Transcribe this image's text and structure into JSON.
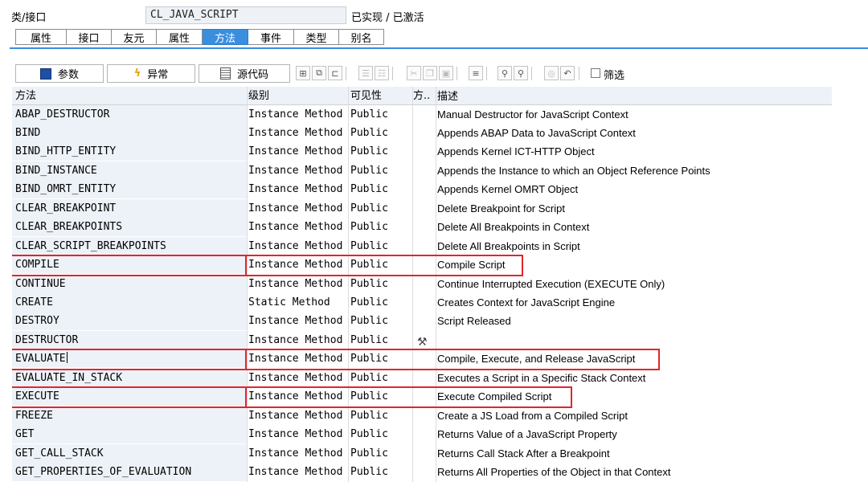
{
  "header": {
    "label": "类/接口",
    "class_name": "CL_JAVA_SCRIPT",
    "status": "已实现 / 已激活"
  },
  "tabs": [
    {
      "label": "属性",
      "active": false
    },
    {
      "label": "接口",
      "active": false
    },
    {
      "label": "友元",
      "active": false
    },
    {
      "label": "属性",
      "active": false
    },
    {
      "label": "方法",
      "active": true
    },
    {
      "label": "事件",
      "active": false
    },
    {
      "label": "类型",
      "active": false
    },
    {
      "label": "别名",
      "active": false
    }
  ],
  "toolbar": {
    "params_label": "参数",
    "exceptions_label": "异常",
    "source_label": "源代码",
    "filter_label": "筛选"
  },
  "columns": {
    "method": "方法",
    "level": "级别",
    "visibility": "可见性",
    "flag": "方.. ",
    "description": "描述"
  },
  "rows": [
    {
      "name": "ABAP_DESTRUCTOR",
      "level": "Instance Method",
      "visibility": "Public",
      "flag": "",
      "description": "Manual Destructor for JavaScript Context"
    },
    {
      "name": "BIND",
      "level": "Instance Method",
      "visibility": "Public",
      "flag": "",
      "description": "Appends ABAP Data to JavaScript Context"
    },
    {
      "name": "BIND_HTTP_ENTITY",
      "level": "Instance Method",
      "visibility": "Public",
      "flag": "",
      "description": "Appends Kernel ICT-HTTP Object"
    },
    {
      "name": "BIND_INSTANCE",
      "level": "Instance Method",
      "visibility": "Public",
      "flag": "",
      "description": "Appends the Instance to which an Object Reference Points"
    },
    {
      "name": "BIND_OMRT_ENTITY",
      "level": "Instance Method",
      "visibility": "Public",
      "flag": "",
      "description": "Appends Kernel OMRT Object"
    },
    {
      "name": "CLEAR_BREAKPOINT",
      "level": "Instance Method",
      "visibility": "Public",
      "flag": "",
      "description": "Delete Breakpoint for Script"
    },
    {
      "name": "CLEAR_BREAKPOINTS",
      "level": "Instance Method",
      "visibility": "Public",
      "flag": "",
      "description": "Delete All Breakpoints in Context"
    },
    {
      "name": "CLEAR_SCRIPT_BREAKPOINTS",
      "level": "Instance Method",
      "visibility": "Public",
      "flag": "",
      "description": "Delete All Breakpoints in Script"
    },
    {
      "name": "COMPILE",
      "level": "Instance Method",
      "visibility": "Public",
      "flag": "",
      "description": "Compile Script"
    },
    {
      "name": "CONTINUE",
      "level": "Instance Method",
      "visibility": "Public",
      "flag": "",
      "description": "Continue Interrupted Execution (EXECUTE Only)"
    },
    {
      "name": "CREATE",
      "level": "Static Method",
      "visibility": "Public",
      "flag": "",
      "description": "Creates Context for JavaScript Engine"
    },
    {
      "name": "DESTROY",
      "level": "Instance Method",
      "visibility": "Public",
      "flag": "",
      "description": "Script Released"
    },
    {
      "name": "DESTRUCTOR",
      "level": "Instance Method",
      "visibility": "Public",
      "flag": "destructor-icon",
      "description": ""
    },
    {
      "name": "EVALUATE",
      "level": "Instance Method",
      "visibility": "Public",
      "flag": "",
      "description": "Compile, Execute, and Release JavaScript"
    },
    {
      "name": "EVALUATE_IN_STACK",
      "level": "Instance Method",
      "visibility": "Public",
      "flag": "",
      "description": "Executes a Script in a Specific Stack Context"
    },
    {
      "name": "EXECUTE",
      "level": "Instance Method",
      "visibility": "Public",
      "flag": "",
      "description": "Execute Compiled Script"
    },
    {
      "name": "FREEZE",
      "level": "Instance Method",
      "visibility": "Public",
      "flag": "",
      "description": "Create a JS Load from a Compiled Script"
    },
    {
      "name": "GET",
      "level": "Instance Method",
      "visibility": "Public",
      "flag": "",
      "description": "Returns Value of a JavaScript Property"
    },
    {
      "name": "GET_CALL_STACK",
      "level": "Instance Method",
      "visibility": "Public",
      "flag": "",
      "description": "Returns Call Stack After a Breakpoint"
    },
    {
      "name": "GET_PROPERTIES_OF_EVALUATION",
      "level": "Instance Method",
      "visibility": "Public",
      "flag": "",
      "description": "Returns All Properties of the Object in that Context"
    }
  ],
  "highlights": [
    {
      "row": "COMPILE",
      "color": "#e0262c"
    },
    {
      "row": "EVALUATE",
      "color": "#e0262c"
    },
    {
      "row": "EXECUTE",
      "color": "#e0262c"
    }
  ]
}
